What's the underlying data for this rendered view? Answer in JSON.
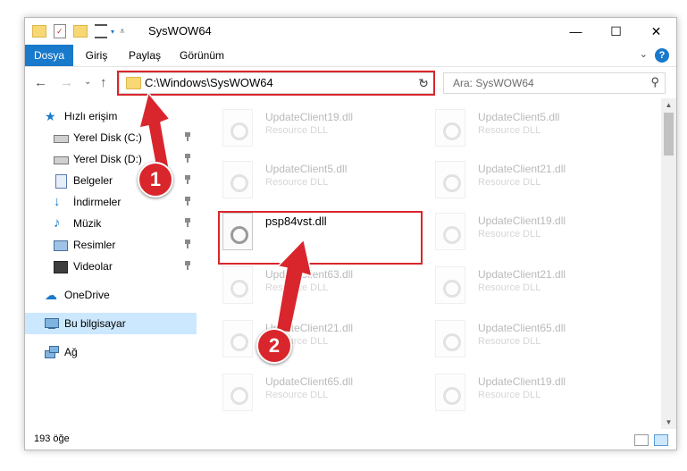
{
  "window": {
    "title": "SysWOW64",
    "minimize_glyph": "—",
    "maximize_glyph": "☐",
    "close_glyph": "✕"
  },
  "ribbon": {
    "tabs": [
      "Dosya",
      "Giriş",
      "Paylaş",
      "Görünüm"
    ],
    "help_glyph": "?",
    "expand_glyph": "⌄"
  },
  "navigation": {
    "back_glyph": "←",
    "forward_glyph": "→",
    "recent_glyph": "⌄",
    "up_glyph": "↑"
  },
  "address": {
    "path": "C:\\Windows\\SysWOW64",
    "dropdown_glyph": "⌄",
    "refresh_glyph": "↻"
  },
  "search": {
    "placeholder": "Ara: SysWOW64",
    "icon_glyph": "⚲"
  },
  "nav_pane": {
    "quick_access": "Hızlı erişim",
    "pinned": [
      {
        "label": "Yerel Disk (C:)",
        "icon": "drive-icon"
      },
      {
        "label": "Yerel Disk (D:)",
        "icon": "drive-icon"
      },
      {
        "label": "Belgeler",
        "icon": "documents-icon"
      },
      {
        "label": "İndirmeler",
        "icon": "downloads-icon"
      },
      {
        "label": "Müzik",
        "icon": "music-icon"
      },
      {
        "label": "Resimler",
        "icon": "pictures-icon"
      },
      {
        "label": "Videolar",
        "icon": "videos-icon"
      }
    ],
    "onedrive": "OneDrive",
    "this_pc": "Bu bilgisayar",
    "network": "Ağ"
  },
  "files": {
    "selected": {
      "name": "psp84vst.dll"
    },
    "left_column": [
      {
        "name": "UpdateClient19.dll",
        "desc": "Resource DLL"
      },
      {
        "name": "UpdateClient5.dll",
        "desc": "Resource DLL"
      },
      {
        "name": "UpdateClient63.dll",
        "desc": "Resource DLL"
      },
      {
        "name": "UpdateClient21.dll",
        "desc": "Resource DLL"
      },
      {
        "name": "UpdateClient65.dll",
        "desc": "Resource DLL"
      }
    ],
    "right_column": [
      {
        "name": "UpdateClient5.dll",
        "desc": "Resource DLL"
      },
      {
        "name": "UpdateClient21.dll",
        "desc": "Resource DLL"
      },
      {
        "name": "UpdateClient19.dll",
        "desc": "Resource DLL"
      },
      {
        "name": "UpdateClient21.dll",
        "desc": "Resource DLL"
      },
      {
        "name": "UpdateClient65.dll",
        "desc": "Resource DLL"
      },
      {
        "name": "UpdateClient19.dll",
        "desc": "Resource DLL"
      }
    ]
  },
  "status": {
    "item_count": "193 öğe"
  },
  "annotations": {
    "step1": "1",
    "step2": "2",
    "color": "#d9262c"
  },
  "colors": {
    "accent": "#1979ca",
    "selection": "#cce8ff"
  }
}
